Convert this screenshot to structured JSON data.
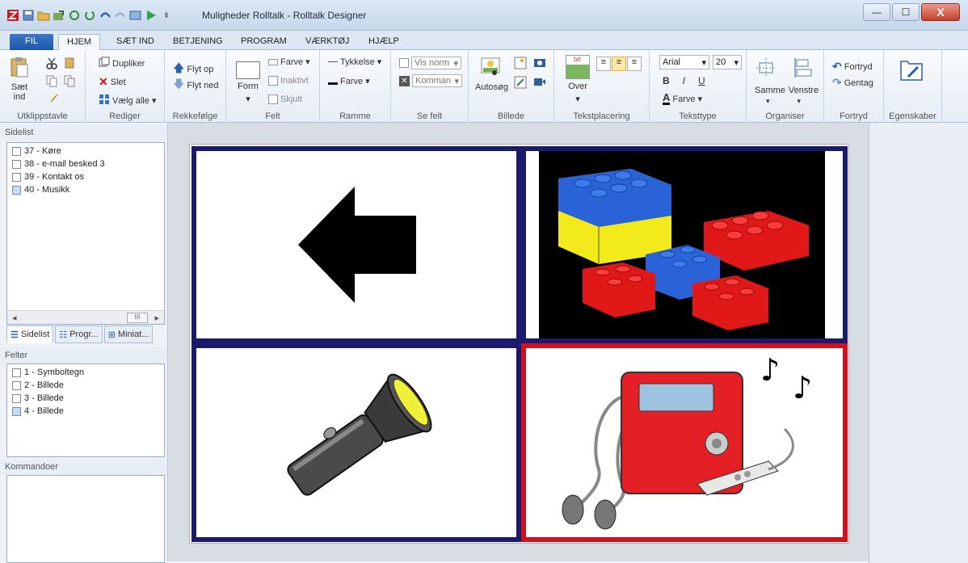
{
  "window": {
    "title": "Muligheder Rolltalk - Rolltalk Designer",
    "minimize": "—",
    "maximize": "☐",
    "close": "X"
  },
  "tabs": [
    {
      "label": "FIL"
    },
    {
      "label": "HJEM"
    },
    {
      "label": "SÆT IND"
    },
    {
      "label": "BETJENING"
    },
    {
      "label": "PROGRAM"
    },
    {
      "label": "VÆRKTØJ"
    },
    {
      "label": "HJÆLP"
    }
  ],
  "ribbon": {
    "clipboard": {
      "paste": "Sæt",
      "paste2": "ind",
      "label": "Utklippstavle"
    },
    "edit": {
      "duplicate": "Dupliker",
      "delete": "Slet",
      "select_all": "Vælg alle",
      "label": "Rediger"
    },
    "order": {
      "up": "Flyt op",
      "down": "Flyt ned",
      "label": "Rekkefølge"
    },
    "field": {
      "form": "Form",
      "color": "Farve",
      "inactive": "Inaktivt",
      "hidden": "Skjult",
      "label": "Felt"
    },
    "frame": {
      "thickness": "Tykkelse",
      "color": "Farve",
      "label": "Ramme"
    },
    "view": {
      "show": "Vis norm",
      "command": "Komman",
      "label": "Se felt"
    },
    "image": {
      "autosearch": "Autosøg",
      "label": "Billede"
    },
    "textplace": {
      "over": "Over",
      "txt": "txt",
      "label": "Tekstplacering"
    },
    "texttype": {
      "font": "Arial",
      "size": "20",
      "bold": "B",
      "italic": "I",
      "underline": "U",
      "color": "Farve",
      "label": "Teksttype"
    },
    "organize": {
      "same": "Samme",
      "left": "Venstre",
      "label": "Organiser"
    },
    "undo": {
      "undo": "Fortryd",
      "redo": "Gentag",
      "label": "Fortryd"
    },
    "props": {
      "label": "Egenskaber"
    }
  },
  "sidelist": {
    "header": "Sidelist",
    "items": [
      "37 - Køre",
      "38 - e-mail besked 3",
      "39 - Kontakt os",
      "40 - Musikk"
    ],
    "tabs": [
      "Sidelist",
      "Progr...",
      "Miniat..."
    ]
  },
  "felter": {
    "header": "Felter",
    "items": [
      "1 - Symboltegn",
      "2 - Billede",
      "3 - Billede",
      "4 - Billede"
    ]
  },
  "kommandoer": {
    "header": "Kommandoer"
  },
  "colors": {
    "cell_border": "#1a1a6e",
    "selected_border": "#d6101a",
    "accent": "#1d56a8"
  }
}
